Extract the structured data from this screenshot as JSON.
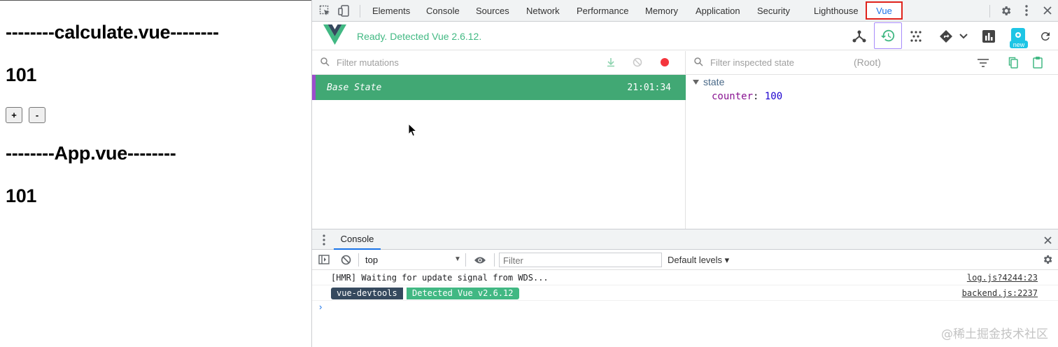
{
  "app": {
    "heading1": "--------calculate.vue--------",
    "value1": "101",
    "plus_label": "+",
    "minus_label": "-",
    "heading2": "--------App.vue--------",
    "value2": "101"
  },
  "devtools": {
    "tabs": [
      "Elements",
      "Console",
      "Sources",
      "Network",
      "Performance",
      "Memory",
      "Application",
      "Security",
      "Lighthouse"
    ],
    "active_tab": "Vue",
    "vue": {
      "status": "Ready. Detected Vue 2.6.12.",
      "new_badge": "new",
      "mutations_filter_placeholder": "Filter mutations",
      "base_state_label": "Base State",
      "base_state_time": "21:01:34",
      "state_filter_placeholder": "Filter inspected state",
      "root_label": "(Root)",
      "state_group": "state",
      "counter_key": "counter",
      "counter_value": "100"
    },
    "drawer": {
      "tab": "Console",
      "context": "top",
      "filter_placeholder": "Filter",
      "levels": "Default levels ▾",
      "logs": [
        {
          "text": "[HMR] Waiting for update signal from WDS...",
          "source": "log.js?4244:23"
        },
        {
          "badge1": "vue-devtools",
          "badge2": "Detected Vue v2.6.12",
          "source": "backend.js:2237"
        }
      ],
      "prompt": "›"
    },
    "colors": {
      "vue_green": "#41b883",
      "vue_dark": "#35495e",
      "highlight_red": "#e0231c",
      "base_state_row": "#41a874"
    }
  },
  "watermark": "@稀土掘金技术社区"
}
